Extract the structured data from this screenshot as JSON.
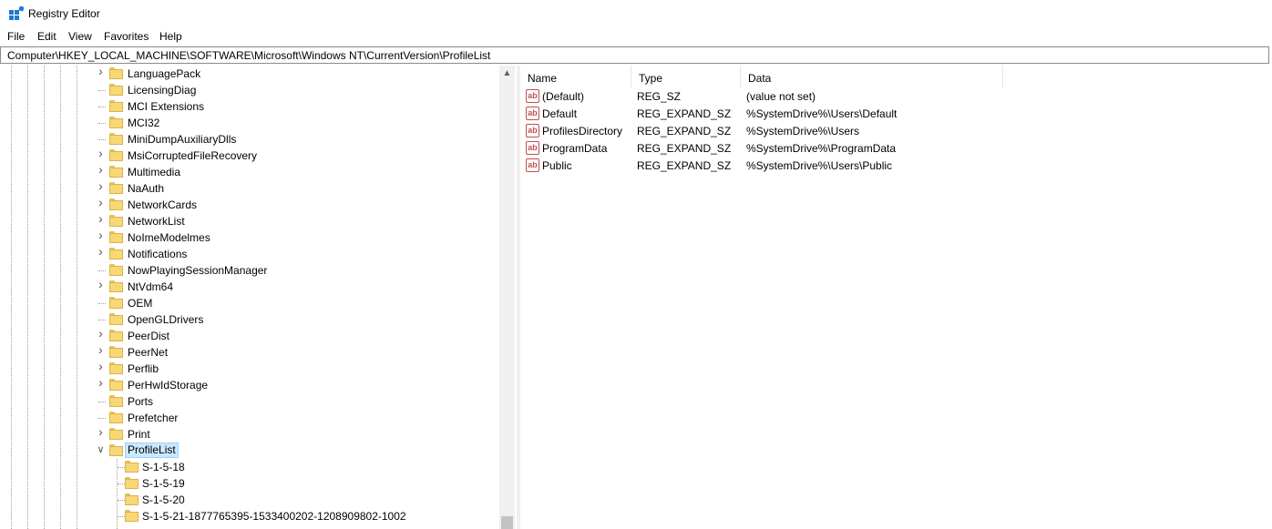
{
  "window": {
    "title": "Registry Editor"
  },
  "menu": [
    "File",
    "Edit",
    "View",
    "Favorites",
    "Help"
  ],
  "address": {
    "path": "Computer\\HKEY_LOCAL_MACHINE\\SOFTWARE\\Microsoft\\Windows NT\\CurrentVersion\\ProfileList"
  },
  "tree": {
    "items": [
      {
        "label": "LanguagePack",
        "expandable": true
      },
      {
        "label": "LicensingDiag",
        "expandable": false
      },
      {
        "label": "MCI Extensions",
        "expandable": false
      },
      {
        "label": "MCI32",
        "expandable": false
      },
      {
        "label": "MiniDumpAuxiliaryDlls",
        "expandable": false
      },
      {
        "label": "MsiCorruptedFileRecovery",
        "expandable": true
      },
      {
        "label": "Multimedia",
        "expandable": true
      },
      {
        "label": "NaAuth",
        "expandable": true
      },
      {
        "label": "NetworkCards",
        "expandable": true
      },
      {
        "label": "NetworkList",
        "expandable": true
      },
      {
        "label": "NoImeModelmes",
        "expandable": true
      },
      {
        "label": "Notifications",
        "expandable": true
      },
      {
        "label": "NowPlayingSessionManager",
        "expandable": false
      },
      {
        "label": "NtVdm64",
        "expandable": true
      },
      {
        "label": "OEM",
        "expandable": false
      },
      {
        "label": "OpenGLDrivers",
        "expandable": false
      },
      {
        "label": "PeerDist",
        "expandable": true
      },
      {
        "label": "PeerNet",
        "expandable": true
      },
      {
        "label": "Perflib",
        "expandable": true
      },
      {
        "label": "PerHwIdStorage",
        "expandable": true
      },
      {
        "label": "Ports",
        "expandable": false
      },
      {
        "label": "Prefetcher",
        "expandable": false
      },
      {
        "label": "Print",
        "expandable": true
      },
      {
        "label": "ProfileList",
        "expandable": true,
        "expanded": true,
        "selected": true
      }
    ],
    "children": [
      {
        "label": "S-1-5-18"
      },
      {
        "label": "S-1-5-19"
      },
      {
        "label": "S-1-5-20"
      },
      {
        "label": "S-1-5-21-1877765395-1533400202-1208909802-1002"
      }
    ]
  },
  "values": {
    "columns": [
      "Name",
      "Type",
      "Data"
    ],
    "rows": [
      {
        "name": "(Default)",
        "type": "REG_SZ",
        "data": "(value not set)",
        "icon": "string-value-icon"
      },
      {
        "name": "Default",
        "type": "REG_EXPAND_SZ",
        "data": "%SystemDrive%\\Users\\Default",
        "icon": "string-value-icon"
      },
      {
        "name": "ProfilesDirectory",
        "type": "REG_EXPAND_SZ",
        "data": "%SystemDrive%\\Users",
        "icon": "string-value-icon"
      },
      {
        "name": "ProgramData",
        "type": "REG_EXPAND_SZ",
        "data": "%SystemDrive%\\ProgramData",
        "icon": "string-value-icon"
      },
      {
        "name": "Public",
        "type": "REG_EXPAND_SZ",
        "data": "%SystemDrive%\\Users\\Public",
        "icon": "string-value-icon"
      }
    ]
  },
  "colors": {
    "selection": "#cce8ff",
    "folder": "#f8d775",
    "value_icon": "#c0504d"
  }
}
